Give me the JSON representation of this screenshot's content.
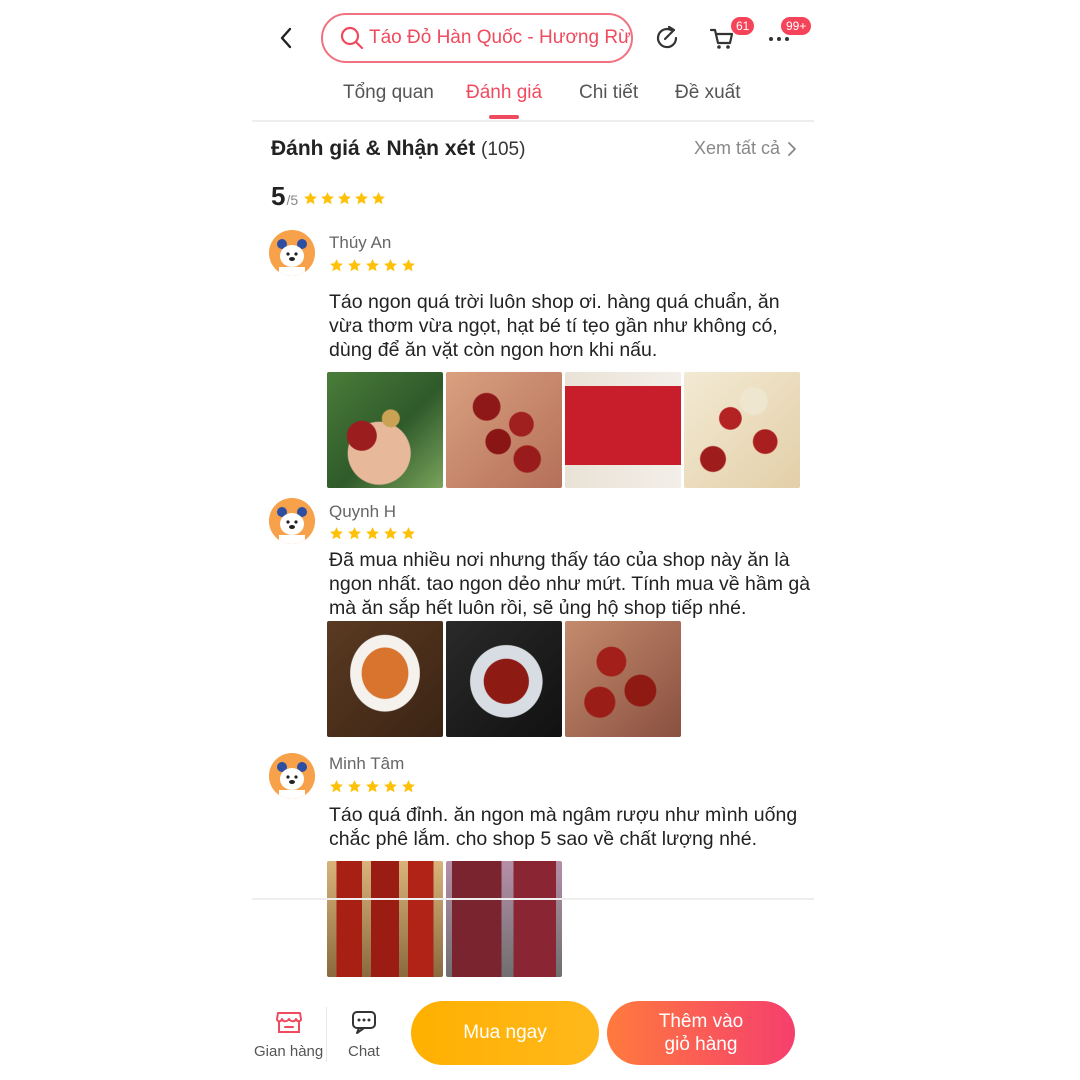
{
  "header": {
    "search_text": "Táo Đỏ Hàn Quốc - Hương Rừng",
    "cart_badge": "61",
    "more_badge": "99+"
  },
  "tabs": [
    {
      "label": "Tổng quan"
    },
    {
      "label": "Đánh giá"
    },
    {
      "label": "Chi tiết"
    },
    {
      "label": "Đề xuất"
    }
  ],
  "active_tab_index": 1,
  "ratings": {
    "title": "Đánh giá & Nhận xét",
    "count": "(105)",
    "see_all": "Xem tất cả",
    "score": "5",
    "score_max": "/5",
    "stars": 5
  },
  "reviews": [
    {
      "name": "Thúy An",
      "stars": 5,
      "text": "Táo ngon quá trời luôn shop ơi. hàng quá chuẩn, ăn vừa thơm vừa ngọt, hạt bé tí tẹo gần như không có, dùng để ăn vặt còn ngon hơn khi nấu.",
      "photo_count": 4
    },
    {
      "name": "Quynh H",
      "stars": 5,
      "text": "Đã mua nhiều nơi nhưng thấy táo của shop này ăn là ngon nhất. tao ngon dẻo như mứt. Tính mua về hầm gà mà ăn sắp hết luôn rồi, sẽ ủng hộ shop tiếp nhé.",
      "photo_count": 3
    },
    {
      "name": "Minh Tâm",
      "stars": 5,
      "text": "Táo quá đỉnh. ăn ngon mà ngâm rượu như mình uống chắc phê lắm. cho shop 5 sao về chất lượng nhé.",
      "photo_count": 2
    }
  ],
  "bottom_bar": {
    "store_label": "Gian hàng",
    "chat_label": "Chat",
    "buy_now": "Mua ngay",
    "add_to_cart": "Thêm vào\ngiỏ hàng"
  },
  "colors": {
    "accent": "#f04a5e",
    "star": "#ffc107",
    "buy_button": "#ffb000",
    "cart_button": "#f53f6e"
  },
  "icons": [
    "back-arrow-icon",
    "search-icon",
    "share-icon",
    "cart-icon",
    "more-icon",
    "star-icon",
    "chevron-right-icon",
    "store-icon",
    "chat-icon"
  ]
}
